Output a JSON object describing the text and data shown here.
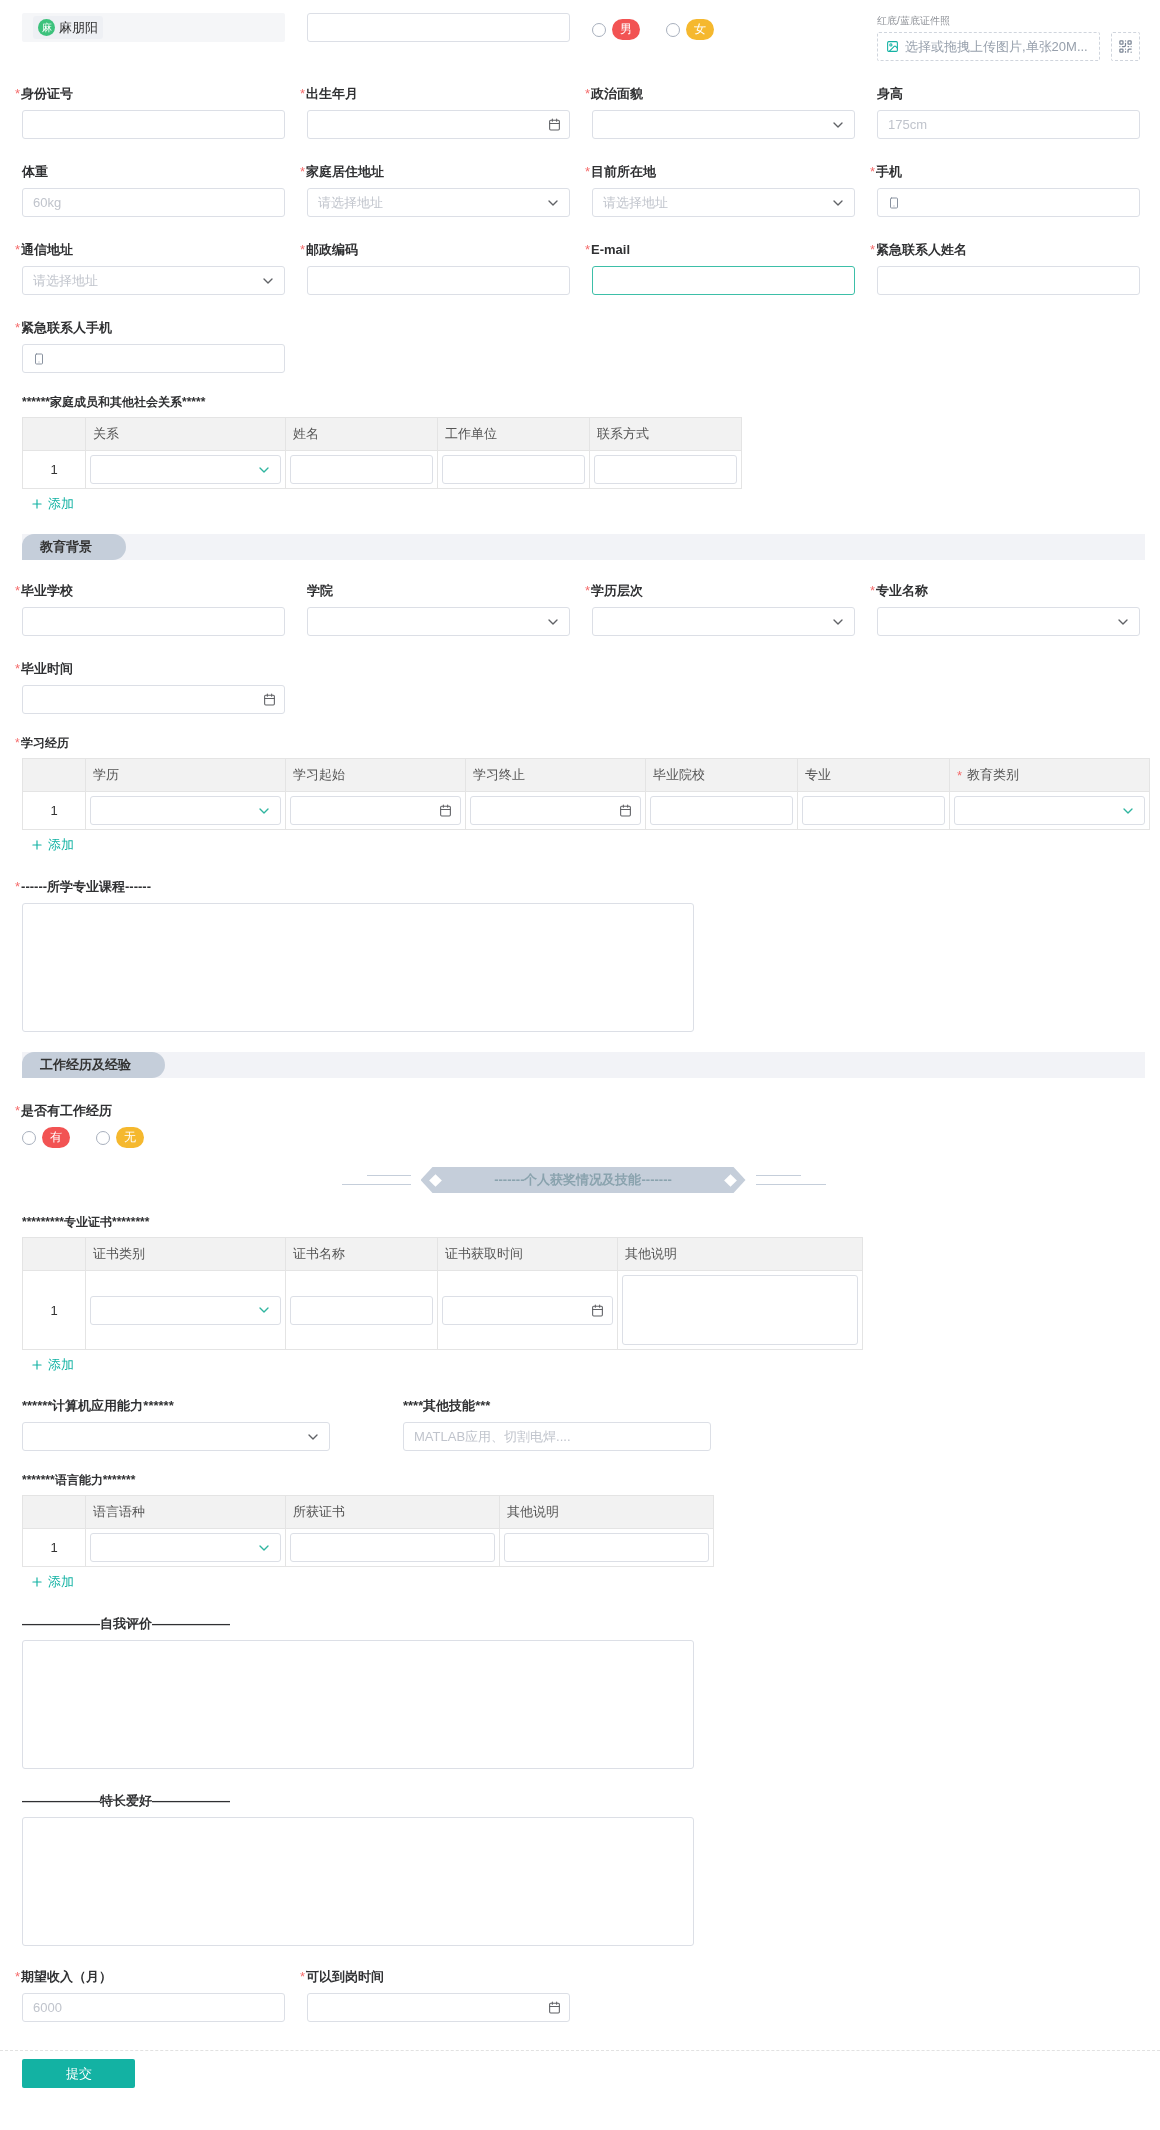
{
  "blocks": [
    {
      "kind": "grid",
      "fields": [
        {
          "kind": "chip",
          "avatar": "麻",
          "value": "麻朋阳"
        },
        {
          "kind": "text",
          "focused": false
        },
        {
          "kind": "radio",
          "options": [
            {
              "label": "男",
              "selected": false,
              "color": "#f25353"
            },
            {
              "label": "女",
              "selected": false,
              "color": "#f5b82e"
            }
          ]
        },
        {
          "kind": "upload",
          "hint": "红底/蓝底证件照",
          "placeholder": "选择或拖拽上传图片,单张20M..."
        },
        {
          "kind": "text",
          "label": "身份证号",
          "required_mark": "*",
          "focused": false
        },
        {
          "kind": "date",
          "label": "出生年月",
          "required_mark": "*",
          "focused": false
        },
        {
          "kind": "select",
          "label": "政治面貌",
          "required_mark": "*",
          "focused": false
        },
        {
          "kind": "text",
          "label": "身高",
          "placeholder": "175cm",
          "focused": false
        },
        {
          "kind": "text",
          "label": "体重",
          "placeholder": "60kg",
          "focused": false
        },
        {
          "kind": "select",
          "label": "家庭居住地址",
          "required_mark": "*",
          "placeholder": "请选择地址",
          "focused": false
        },
        {
          "kind": "select",
          "label": "目前所在地",
          "required_mark": "*",
          "placeholder": "请选择地址",
          "focused": false
        },
        {
          "kind": "phone",
          "label": "手机",
          "required_mark": "*",
          "focused": false
        },
        {
          "kind": "select",
          "label": "通信地址",
          "required_mark": "*",
          "placeholder": "请选择地址",
          "focused": false
        },
        {
          "kind": "text",
          "label": "邮政编码",
          "required_mark": "*",
          "focused": false
        },
        {
          "kind": "text",
          "label": "E-mail",
          "required_mark": "*",
          "focused": true
        },
        {
          "kind": "text",
          "label": "紧急联系人姓名",
          "required_mark": "*",
          "focused": false
        },
        {
          "kind": "phone",
          "label": "紧急联系人手机",
          "required_mark": "*",
          "focused": false
        }
      ]
    },
    {
      "kind": "table",
      "title": "******家庭成员和其他社会关系*****",
      "add_label": "添加",
      "columns": [
        {
          "label": "关系",
          "kind": "select"
        },
        {
          "label": "姓名",
          "kind": "text"
        },
        {
          "label": "工作单位",
          "kind": "text"
        },
        {
          "label": "联系方式",
          "kind": "text"
        }
      ],
      "rows": [
        {
          "index": "1"
        }
      ]
    },
    {
      "kind": "banner",
      "title": "教育背景"
    },
    {
      "kind": "grid",
      "fields": [
        {
          "kind": "text",
          "label": "毕业学校",
          "required_mark": "*",
          "focused": false
        },
        {
          "kind": "select",
          "label": "学院",
          "focused": false
        },
        {
          "kind": "select",
          "label": "学历层次",
          "required_mark": "*",
          "focused": false
        },
        {
          "kind": "select",
          "label": "专业名称",
          "required_mark": "*",
          "focused": false
        },
        {
          "kind": "date",
          "label": "毕业时间",
          "required_mark": "*",
          "focused": false
        }
      ]
    },
    {
      "kind": "table",
      "title": "学习经历",
      "required_mark": "*",
      "add_label": "添加",
      "columns": [
        {
          "label": "学历",
          "kind": "select"
        },
        {
          "label": "学习起始",
          "kind": "date"
        },
        {
          "label": "学习终止",
          "kind": "date"
        },
        {
          "label": "毕业院校",
          "kind": "text"
        },
        {
          "label": "专业",
          "kind": "text"
        },
        {
          "label": "教育类别",
          "required_mark": "*",
          "kind": "select"
        }
      ],
      "rows": [
        {
          "index": "1"
        }
      ]
    },
    {
      "kind": "textarea",
      "label": "------所学专业课程------",
      "required_mark": "*"
    },
    {
      "kind": "banner",
      "title": "工作经历及经验"
    },
    {
      "kind": "radio",
      "label": "是否有工作经历",
      "required_mark": "*",
      "options": [
        {
          "label": "有",
          "selected": false,
          "color": "#f25353"
        },
        {
          "label": "无",
          "selected": false,
          "color": "#f5b82e"
        }
      ]
    },
    {
      "kind": "ribbon",
      "title": "-------个人获奖情况及技能-------"
    },
    {
      "kind": "table",
      "title": "*********专业证书********",
      "add_label": "添加",
      "columns": [
        {
          "label": "证书类别",
          "kind": "select"
        },
        {
          "label": "证书名称",
          "kind": "text"
        },
        {
          "label": "证书获取时间",
          "kind": "date"
        },
        {
          "label": "其他说明",
          "kind": "textarea"
        }
      ],
      "rows": [
        {
          "index": "1"
        }
      ]
    },
    {
      "kind": "grid-wide",
      "fields": [
        {
          "kind": "select",
          "label": "******计算机应用能力******",
          "focused": false
        },
        {
          "kind": "text",
          "label": "****其他技能***",
          "placeholder": "MATLAB应用、切割电焊....",
          "focused": false
        }
      ]
    },
    {
      "kind": "table",
      "title": "*******语言能力*******",
      "add_label": "添加",
      "columns": [
        {
          "label": "语言语种",
          "kind": "select"
        },
        {
          "label": "所获证书",
          "kind": "wide"
        },
        {
          "label": "其他说明",
          "kind": "wide"
        }
      ],
      "rows": [
        {
          "index": "1"
        }
      ]
    },
    {
      "kind": "textarea",
      "label": "——————自我评价——————"
    },
    {
      "kind": "textarea",
      "label": "——————特长爱好——————"
    },
    {
      "kind": "grid",
      "fields": [
        {
          "kind": "text",
          "label": "期望收入（月）",
          "required_mark": "*",
          "placeholder": "6000",
          "focused": false
        },
        {
          "kind": "date",
          "label": "可以到岗时间",
          "required_mark": "*",
          "focused": false
        }
      ]
    }
  ],
  "footer": {
    "submit_label": "提交"
  }
}
